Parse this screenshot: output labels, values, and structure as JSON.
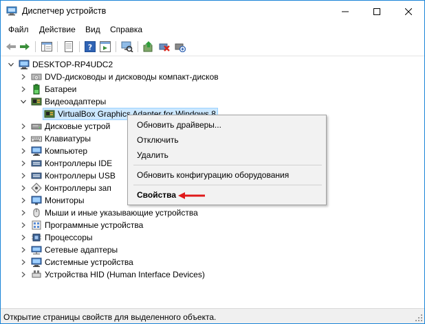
{
  "window": {
    "title": "Диспетчер устройств"
  },
  "menu": [
    "Файл",
    "Действие",
    "Вид",
    "Справка"
  ],
  "toolbar": {
    "buttons": [
      "back-icon",
      "forward-icon",
      "properties-view-icon",
      "properties-icon",
      "help-icon",
      "view-icon",
      "computer-scan-icon",
      "update-driver-icon",
      "uninstall-icon",
      "add-hardware-icon"
    ]
  },
  "tree": {
    "root": "DESKTOP-RP4UDC2",
    "items": [
      {
        "label": "DVD-дисководы и дисководы компакт-дисков",
        "icon": "dvd-icon",
        "expanded": false
      },
      {
        "label": "Батареи",
        "icon": "battery-icon",
        "expanded": false
      },
      {
        "label": "Видеоадаптеры",
        "icon": "display-adapter-icon",
        "expanded": true
      },
      {
        "label": "VirtualBox Graphics Adapter for Windows 8",
        "icon": "display-adapter-icon",
        "child": true,
        "selected": true
      },
      {
        "label": "Дисковые устрой",
        "icon": "disk-icon",
        "expanded": false
      },
      {
        "label": "Клавиатуры",
        "icon": "keyboard-icon",
        "expanded": false
      },
      {
        "label": "Компьютер",
        "icon": "computer-icon",
        "expanded": false
      },
      {
        "label": "Контроллеры IDE",
        "icon": "ide-icon",
        "expanded": false
      },
      {
        "label": "Контроллеры USB",
        "icon": "usb-icon",
        "expanded": false
      },
      {
        "label": "Контроллеры зап",
        "icon": "storage-icon",
        "expanded": false
      },
      {
        "label": "Мониторы",
        "icon": "monitor-icon",
        "expanded": false
      },
      {
        "label": "Мыши и иные указывающие устройства",
        "icon": "mouse-icon",
        "expanded": false
      },
      {
        "label": "Программные устройства",
        "icon": "software-device-icon",
        "expanded": false
      },
      {
        "label": "Процессоры",
        "icon": "processor-icon",
        "expanded": false
      },
      {
        "label": "Сетевые адаптеры",
        "icon": "network-icon",
        "expanded": false
      },
      {
        "label": "Системные устройства",
        "icon": "system-icon",
        "expanded": false
      },
      {
        "label": "Устройства HID (Human Interface Devices)",
        "icon": "hid-icon",
        "expanded": false
      }
    ]
  },
  "context_menu": {
    "items": [
      {
        "label": "Обновить драйверы..."
      },
      {
        "label": "Отключить"
      },
      {
        "label": "Удалить"
      },
      {
        "label": "Обновить конфигурацию оборудования"
      },
      {
        "label": "Свойства",
        "bold": true
      }
    ]
  },
  "status": {
    "text": "Открытие страницы свойств для выделенного объекта."
  },
  "colors": {
    "selection": "#cce8ff",
    "accent": "#1883d7",
    "arrow": "#e0191a"
  }
}
